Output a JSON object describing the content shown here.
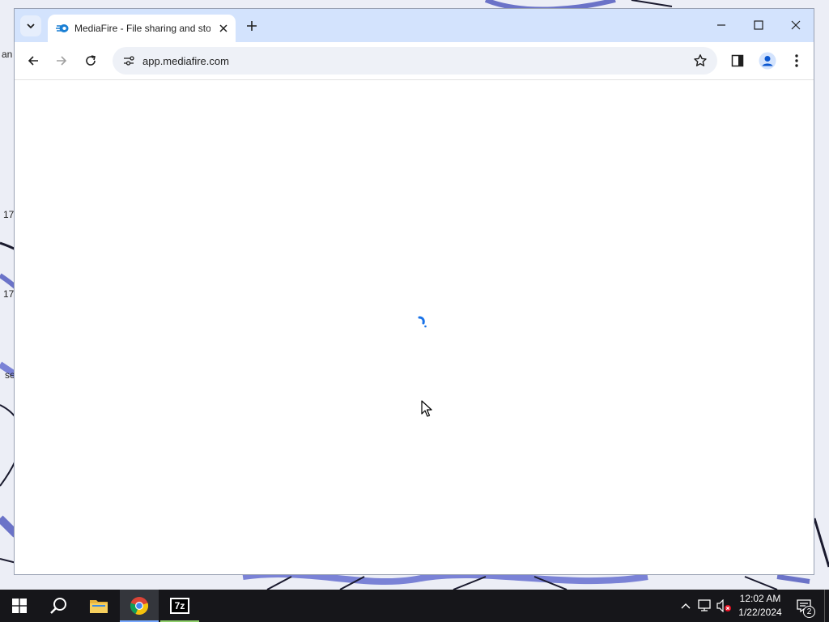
{
  "desktop": {
    "fragments": [
      "an",
      "17",
      "17",
      "se"
    ]
  },
  "browser": {
    "tab": {
      "title": "MediaFire - File sharing and storage",
      "favicon": "mediafire-icon"
    },
    "toolbar": {
      "url": "app.mediafire.com"
    },
    "page": {
      "state": "loading"
    }
  },
  "taskbar": {
    "apps": [
      "start",
      "search",
      "file-explorer",
      "chrome",
      "7-zip"
    ],
    "seven_zip_label": "7z",
    "clock": {
      "time": "12:02 AM",
      "date": "1/22/2024"
    },
    "notification_count": "2"
  },
  "colors": {
    "accent": "#0b57d0",
    "tabstrip": "#d3e3fd",
    "taskbar": "#16161a"
  }
}
